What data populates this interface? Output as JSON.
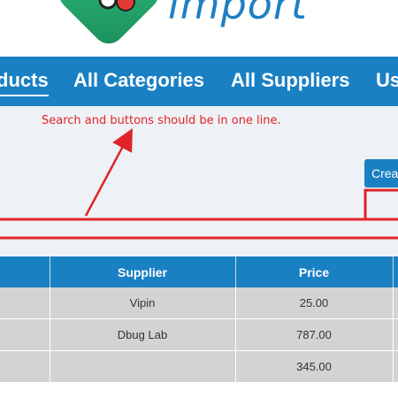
{
  "logo": {
    "text": "import",
    "mark_icon": "logo-badge-icon"
  },
  "nav": {
    "items": [
      {
        "label": "ducts",
        "active": true
      },
      {
        "label": "All Categories",
        "active": false
      },
      {
        "label": "All Suppliers",
        "active": false
      },
      {
        "label": "Us",
        "active": false
      }
    ]
  },
  "annotation": {
    "text": "Search and buttons should be in one line.",
    "color": "#e0242a"
  },
  "toolbar": {
    "create_label": "Create"
  },
  "table": {
    "headers": [
      "",
      "Supplier",
      "Price",
      ""
    ],
    "rows": [
      [
        "",
        "Vipin",
        "25.00",
        ""
      ],
      [
        "",
        "Dbug Lab",
        "787.00",
        ""
      ],
      [
        "",
        "",
        "345.00",
        ""
      ]
    ]
  },
  "colors": {
    "primary": "#1a80c4",
    "content_bg": "#eef1f5",
    "row_bg": "#d3d3d3",
    "logo_green": "#2ec27e"
  }
}
